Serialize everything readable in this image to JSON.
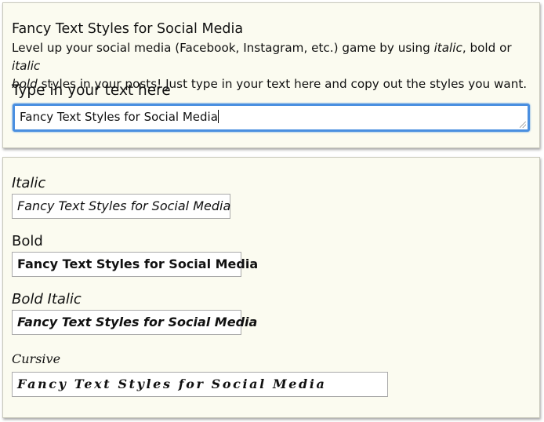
{
  "header": {
    "title": "Fancy Text Styles for Social Media",
    "desc_part1": "Level up your social media (Facebook, Instagram, etc.) game by using ",
    "desc_italic": "italic",
    "desc_part2": ", bold or ",
    "desc_bolditalic_1": "italic",
    "desc_bolditalic_2": "bold",
    "desc_part3": " styles in your posts! Just type in your text here and copy out the styles you want."
  },
  "input": {
    "label": "Type in your text here",
    "value": "Fancy Text Styles for Social Media"
  },
  "styles": {
    "italic": {
      "label": "Italic",
      "text": "Fancy Text Styles for Social Media"
    },
    "bold": {
      "label": "Bold",
      "text": "Fancy Text Styles for Social Media"
    },
    "bold_italic": {
      "label": "Bold Italic",
      "text": "Fancy Text Styles for Social Media"
    },
    "cursive": {
      "label": "Cursive",
      "text": "Fancy Text Styles for Social Media"
    }
  },
  "colors": {
    "panel_bg": "#fbfbf0",
    "focus_border": "#4a8fe0"
  }
}
